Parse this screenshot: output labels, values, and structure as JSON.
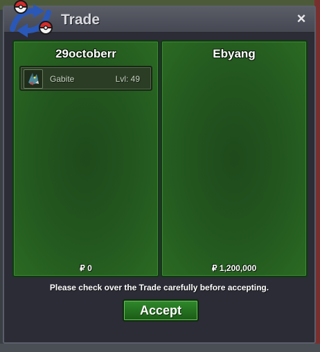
{
  "window": {
    "title": "Trade",
    "close_label": "×"
  },
  "left_panel": {
    "player_name": "29octoberr",
    "items": [
      {
        "name": "Gabite",
        "level": "Lvl: 49"
      }
    ],
    "money": "₽ 0"
  },
  "right_panel": {
    "player_name": "Ebyang",
    "items": [],
    "money": "₽ 1,200,000"
  },
  "footer": {
    "notice": "Please check over the Trade carefully before accepting.",
    "accept_label": "Accept"
  },
  "colors": {
    "panel_green": "#23581f",
    "accent_button": "#2f8a2a",
    "window_bg": "#2b2c36"
  }
}
